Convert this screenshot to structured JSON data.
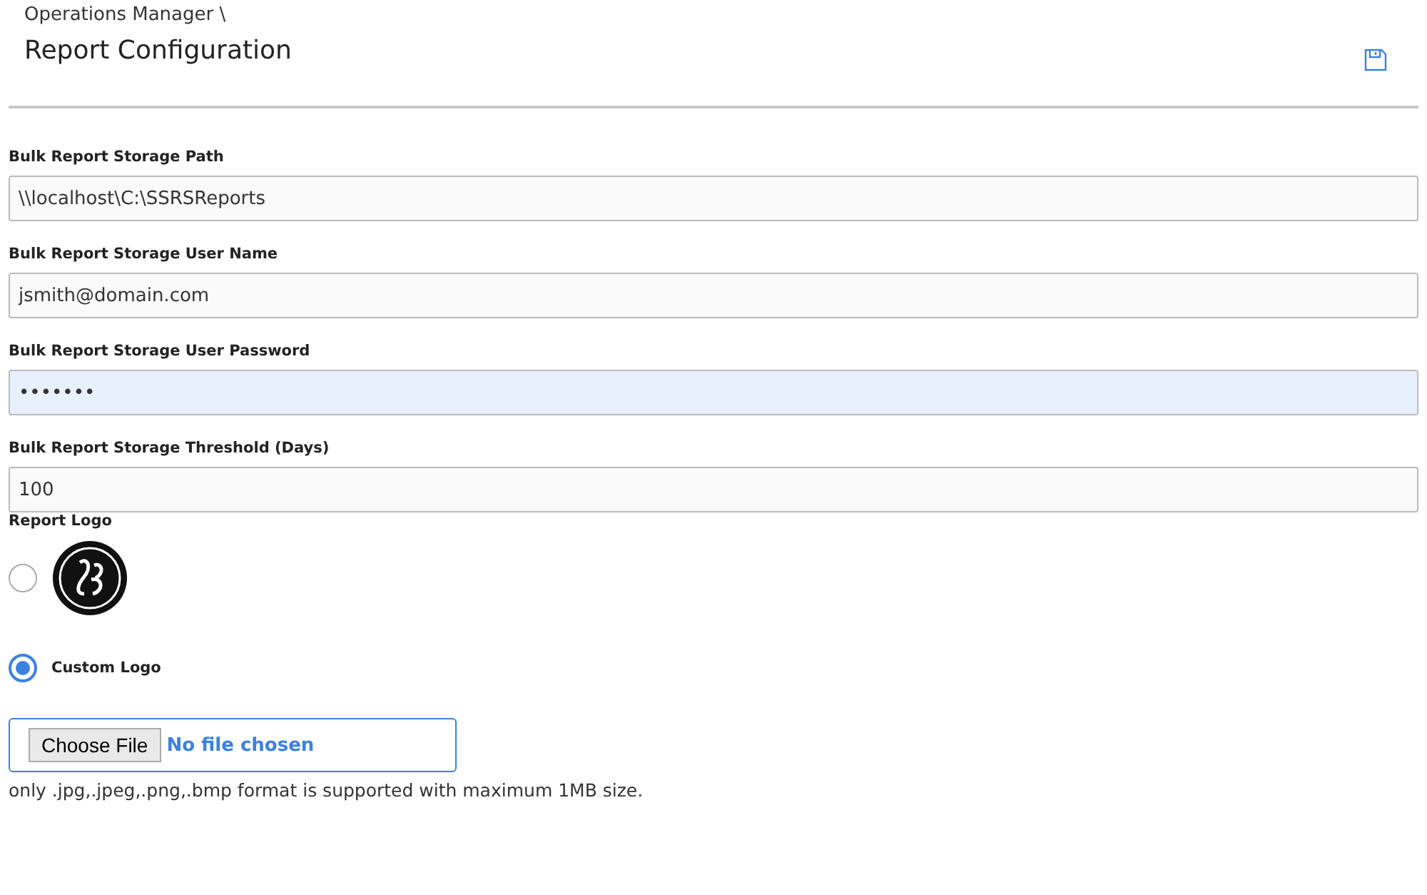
{
  "breadcrumb": "Operations Manager \\",
  "title": "Report Configuration",
  "fields": [
    {
      "label": "Bulk Report Storage Path",
      "value": "\\\\localhost\\C:\\SSRSReports",
      "focused": false
    },
    {
      "label": "Bulk Report Storage User Name",
      "value": "jsmith@domain.com",
      "focused": false
    },
    {
      "label": "Bulk Report Storage User Password",
      "value": "•••••••",
      "focused": true
    },
    {
      "label": "Bulk Report Storage Threshold (Days)",
      "value": "100",
      "focused": false
    }
  ],
  "logo_section": {
    "label": "Report Logo",
    "options": [
      {
        "kind": "image",
        "selected": false
      },
      {
        "kind": "text",
        "label": "Custom Logo",
        "selected": true
      }
    ]
  },
  "file_picker": {
    "button": "Choose File",
    "status": "No file chosen"
  },
  "hint": "only .jpg,.jpeg,.png,.bmp format is supported with maximum 1MB size."
}
